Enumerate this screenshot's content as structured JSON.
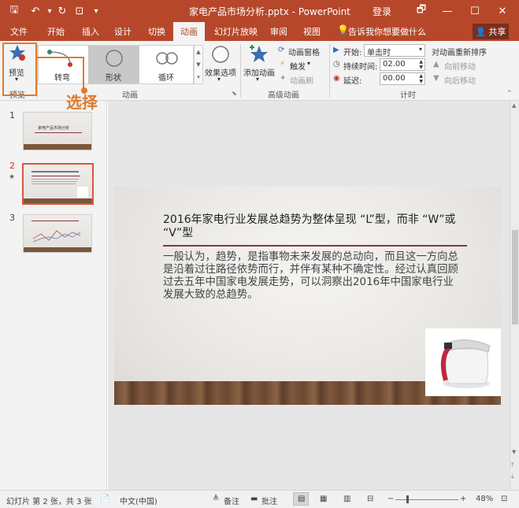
{
  "titlebar": {
    "title": "家电产品市场分析.pptx - PowerPoint",
    "login": "登录",
    "qa_save": "🖫",
    "qa_undo": "↶",
    "qa_redo": "↻",
    "qa_start": "⊡",
    "qa_more": "▾",
    "win_restore": "🗗",
    "win_min": "—",
    "win_max": "☐",
    "win_close": "✕"
  },
  "tabs": {
    "file": "文件",
    "home": "开始",
    "insert": "插入",
    "design": "设计",
    "transitions": "切换",
    "animations": "动画",
    "slideshow": "幻灯片放映",
    "review": "审阅",
    "view": "视图",
    "tellme": "告诉我你想要做什么",
    "share": "共享"
  },
  "ribbon": {
    "preview_label": "预览",
    "preview_group": "预览",
    "anim_items": [
      "转弯",
      "形状",
      "循环"
    ],
    "effect_options": "效果选项",
    "animation_group": "动画",
    "add_animation": "添加动画",
    "anim_pane": "动画窗格",
    "trigger": "触发",
    "anim_painter": "动画刷",
    "advanced_group": "高级动画",
    "start_label": "开始:",
    "start_value": "单击时",
    "duration_label": "持续时间:",
    "duration_value": "02.00",
    "delay_label": "延迟:",
    "delay_value": "00.00",
    "timing_group": "计时",
    "reorder_label": "对动画重新排序",
    "move_earlier": "向前移动",
    "move_later": "向后移动"
  },
  "annotation": {
    "text": "选择"
  },
  "thumbs": {
    "slides": [
      {
        "num": "1",
        "title": "家电产品市场分析"
      },
      {
        "num": "2",
        "title": ""
      },
      {
        "num": "3",
        "title": ""
      }
    ],
    "star": "★"
  },
  "slide": {
    "title": "2016年家电行业发展总趋势为整体呈现 “L”型，而非 “W”或 “V”型",
    "body": "一般认为，趋势，是指事物未来发展的总动向，而且这一方向总是沿着过往路径依势而行，并伴有某种不确定性。经过认真回顾过去五年中国家电发展走势，可以洞察出2016年中国家电行业发展大致的总趋势。"
  },
  "status": {
    "slide_info": "幻灯片 第 2 张，共 3 张",
    "language": "中文(中国)",
    "notes": "备注",
    "comments": "批注",
    "zoom": "48%"
  },
  "colors": {
    "accent": "#b7472a",
    "annotation": "#e07a2e",
    "title_rule": "#8d3347"
  }
}
